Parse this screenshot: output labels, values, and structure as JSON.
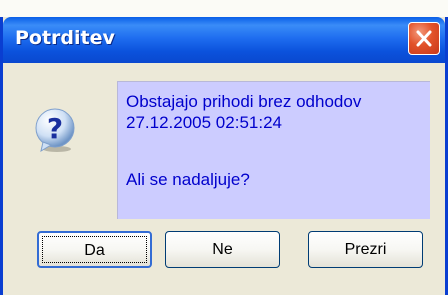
{
  "dialog": {
    "title": "Potrditev",
    "message_lines": [
      "Obstajajo prihodi brez odhodov",
      "27.12.2005 02:51:24",
      "Ali se nadaljuje?"
    ],
    "icon": "question-icon",
    "buttons": {
      "yes": "Da",
      "no": "Ne",
      "ignore": "Prezri"
    }
  },
  "colors": {
    "titlebar": "#0a5fe7",
    "message_background": "#ccccff",
    "message_text": "#0000cc",
    "dialog_background": "#ece9d8"
  }
}
